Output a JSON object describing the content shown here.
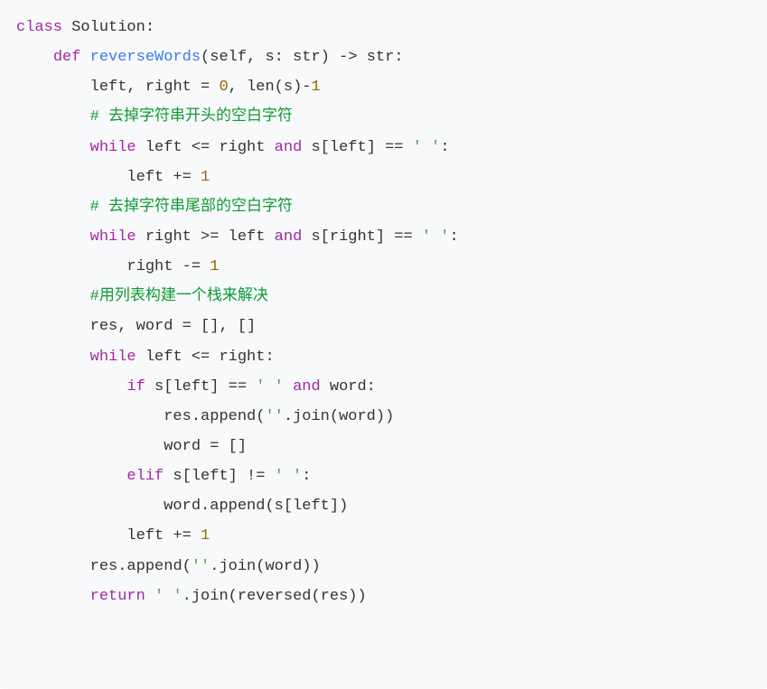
{
  "code": {
    "line1": {
      "kw_class": "class",
      "cls": "Solution",
      "colon": ":"
    },
    "line2": {
      "kw_def": "def",
      "fn": "reverseWords",
      "p_open": "(",
      "self": "self",
      "comma": ",",
      "space": " ",
      "s": "s",
      "colon_ann": ":",
      "ann_type": "str",
      "p_close": ")",
      "arrow": " -> ",
      "ret_type": "str",
      "colon": ":"
    },
    "line3": {
      "ids": "left, right = ",
      "zero": "0",
      "comma": ", ",
      "len": "len",
      "p_open": "(",
      "s": "s",
      "p_close": ")",
      "minus": "-",
      "one": "1"
    },
    "line4": {
      "cmt": "# 去掉字符串开头的空白字符"
    },
    "line5": {
      "kw_while": "while",
      "left": " left <= right ",
      "kw_and": "and",
      "cond2a": " s[left] == ",
      "str": "' '",
      "colon": ":"
    },
    "line6": {
      "body": "left += ",
      "one": "1"
    },
    "line7": {
      "cmt": "# 去掉字符串尾部的空白字符"
    },
    "line8": {
      "kw_while": "while",
      "cond1": " right >= left ",
      "kw_and": "and",
      "cond2a": " s[right] == ",
      "str": "' '",
      "colon": ":"
    },
    "line9": {
      "body": "right -= ",
      "one": "1"
    },
    "line10": {
      "cmt": "#用列表构建一个栈来解决"
    },
    "line11": {
      "text": "res, word = [], []"
    },
    "line12": {
      "kw_while": "while",
      "cond": " left <= right:"
    },
    "line13": {
      "kw_if": "if",
      "cond": " s[left] == ",
      "str": "' '",
      "sp": " ",
      "kw_and": "and",
      "tail": " word:"
    },
    "line14": {
      "pre": "res.append(",
      "str": "''",
      "post": ".join(word))"
    },
    "line15": {
      "text": "word = []"
    },
    "line16": {
      "kw_elif": "elif",
      "cond": " s[left] != ",
      "str": "' '",
      "colon": ":"
    },
    "line17": {
      "text": "word.append(s[left])"
    },
    "line18": {
      "text": "left += ",
      "one": "1"
    },
    "line19": {
      "pre": "res.append(",
      "str": "''",
      "post": ".join(word))"
    },
    "line20": {
      "kw_return": "return",
      "sp": " ",
      "str": "' '",
      "post": ".join(",
      "rev": "reversed",
      "tail": "(res))"
    }
  }
}
